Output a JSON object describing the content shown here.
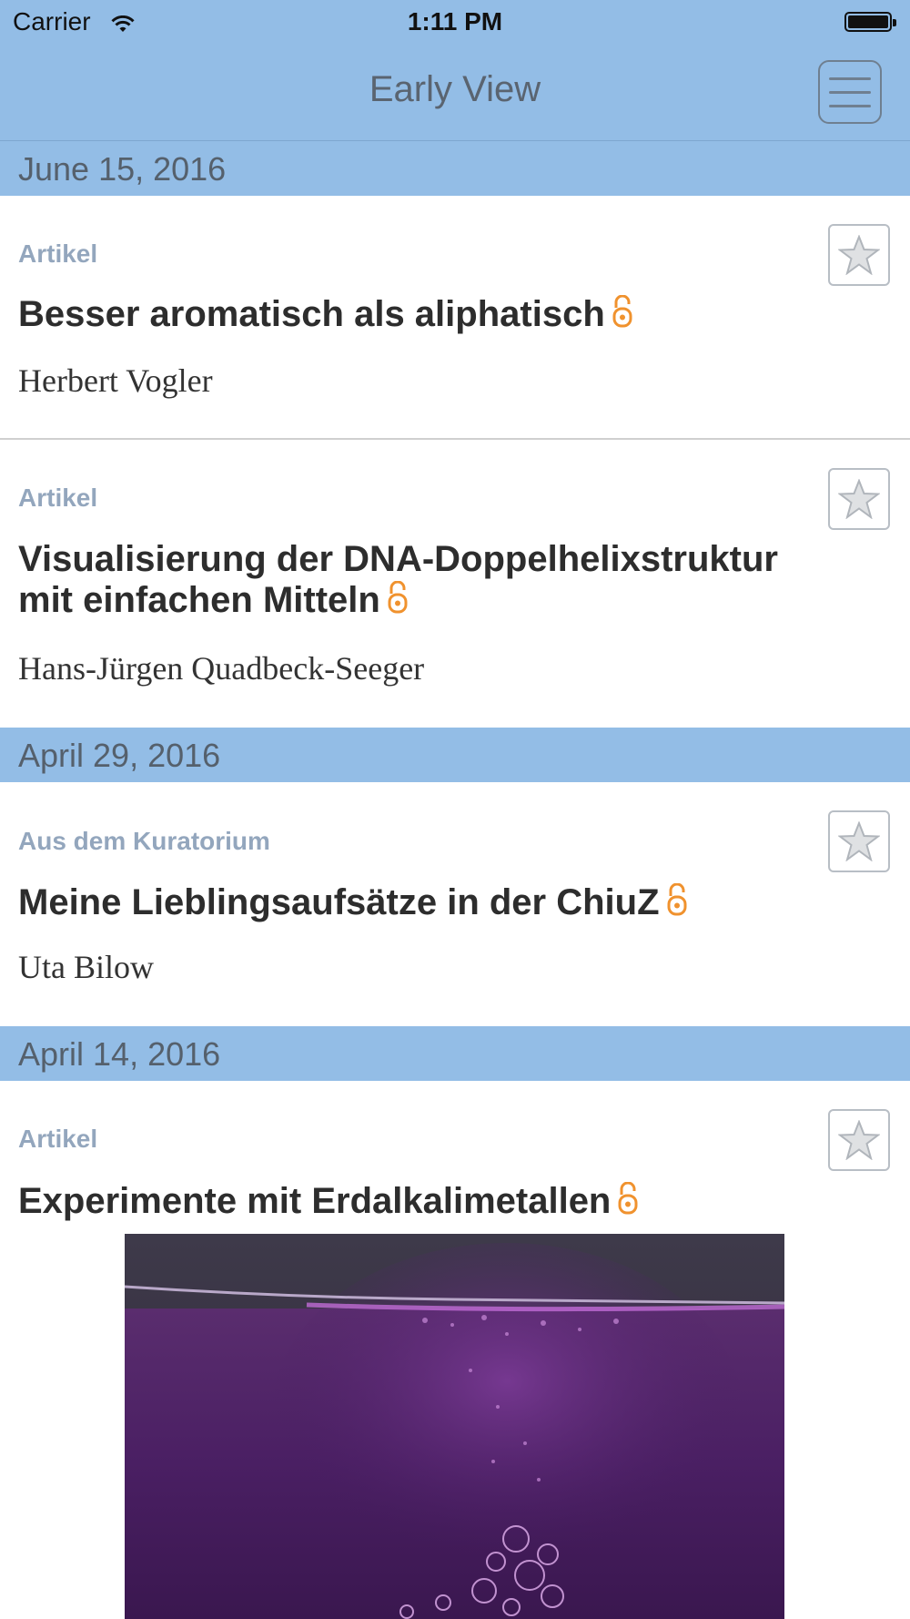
{
  "status_bar": {
    "carrier": "Carrier",
    "time": "1:11 PM"
  },
  "nav": {
    "title": "Early View",
    "menu_icon": "hamburger-menu-icon"
  },
  "colors": {
    "header_blue": "#93bde6",
    "category_gray": "#93a6bd",
    "lock_orange": "#f0922e"
  },
  "sections": [
    {
      "date": "June 15, 2016",
      "articles": [
        {
          "category": "Artikel",
          "title": "Besser aromatisch als aliphatisch",
          "author": "Herbert Vogler",
          "open_access_icon": "open-lock-icon",
          "favorite_icon": "star-icon"
        },
        {
          "category": "Artikel",
          "title": "Visualisierung der DNA-Doppelhelixstruktur mit einfachen Mitteln",
          "author": "Hans-Jürgen Quadbeck-Seeger",
          "open_access_icon": "open-lock-icon",
          "favorite_icon": "star-icon"
        }
      ]
    },
    {
      "date": "April 29, 2016",
      "articles": [
        {
          "category": "Aus dem Kuratorium",
          "title": "Meine Lieblingsaufsätze in der ChiuZ",
          "author": "Uta Bilow",
          "open_access_icon": "open-lock-icon",
          "favorite_icon": "star-icon"
        }
      ]
    },
    {
      "date": "April 14, 2016",
      "articles": [
        {
          "category": "Artikel",
          "title": "Experimente mit Erdalkalimetallen",
          "open_access_icon": "open-lock-icon",
          "favorite_icon": "star-icon",
          "image": "purple-liquid-bubbles-photo"
        }
      ]
    }
  ]
}
